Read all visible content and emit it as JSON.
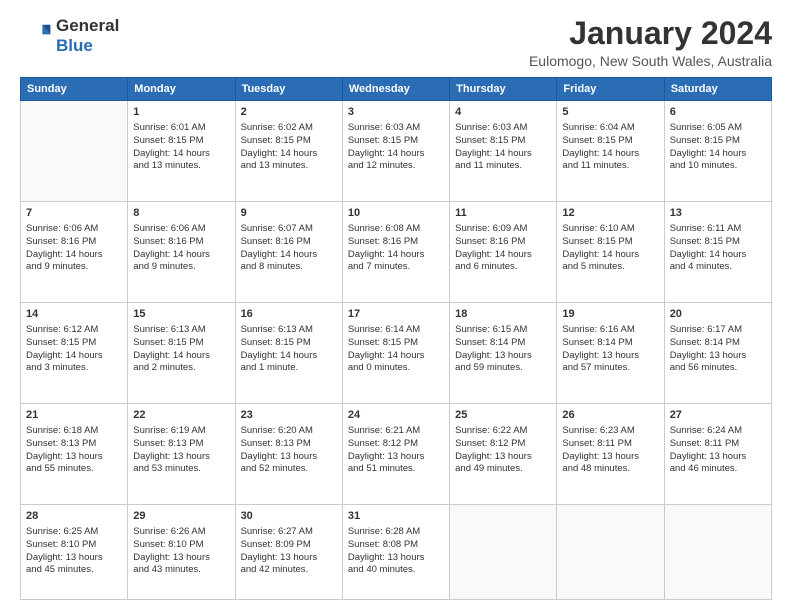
{
  "logo": {
    "line1": "General",
    "line2": "Blue"
  },
  "title": "January 2024",
  "subtitle": "Eulomogo, New South Wales, Australia",
  "days_of_week": [
    "Sunday",
    "Monday",
    "Tuesday",
    "Wednesday",
    "Thursday",
    "Friday",
    "Saturday"
  ],
  "weeks": [
    [
      {
        "day": "",
        "info": ""
      },
      {
        "day": "1",
        "info": "Sunrise: 6:01 AM\nSunset: 8:15 PM\nDaylight: 14 hours\nand 13 minutes."
      },
      {
        "day": "2",
        "info": "Sunrise: 6:02 AM\nSunset: 8:15 PM\nDaylight: 14 hours\nand 13 minutes."
      },
      {
        "day": "3",
        "info": "Sunrise: 6:03 AM\nSunset: 8:15 PM\nDaylight: 14 hours\nand 12 minutes."
      },
      {
        "day": "4",
        "info": "Sunrise: 6:03 AM\nSunset: 8:15 PM\nDaylight: 14 hours\nand 11 minutes."
      },
      {
        "day": "5",
        "info": "Sunrise: 6:04 AM\nSunset: 8:15 PM\nDaylight: 14 hours\nand 11 minutes."
      },
      {
        "day": "6",
        "info": "Sunrise: 6:05 AM\nSunset: 8:15 PM\nDaylight: 14 hours\nand 10 minutes."
      }
    ],
    [
      {
        "day": "7",
        "info": "Sunrise: 6:06 AM\nSunset: 8:16 PM\nDaylight: 14 hours\nand 9 minutes."
      },
      {
        "day": "8",
        "info": "Sunrise: 6:06 AM\nSunset: 8:16 PM\nDaylight: 14 hours\nand 9 minutes."
      },
      {
        "day": "9",
        "info": "Sunrise: 6:07 AM\nSunset: 8:16 PM\nDaylight: 14 hours\nand 8 minutes."
      },
      {
        "day": "10",
        "info": "Sunrise: 6:08 AM\nSunset: 8:16 PM\nDaylight: 14 hours\nand 7 minutes."
      },
      {
        "day": "11",
        "info": "Sunrise: 6:09 AM\nSunset: 8:16 PM\nDaylight: 14 hours\nand 6 minutes."
      },
      {
        "day": "12",
        "info": "Sunrise: 6:10 AM\nSunset: 8:15 PM\nDaylight: 14 hours\nand 5 minutes."
      },
      {
        "day": "13",
        "info": "Sunrise: 6:11 AM\nSunset: 8:15 PM\nDaylight: 14 hours\nand 4 minutes."
      }
    ],
    [
      {
        "day": "14",
        "info": "Sunrise: 6:12 AM\nSunset: 8:15 PM\nDaylight: 14 hours\nand 3 minutes."
      },
      {
        "day": "15",
        "info": "Sunrise: 6:13 AM\nSunset: 8:15 PM\nDaylight: 14 hours\nand 2 minutes."
      },
      {
        "day": "16",
        "info": "Sunrise: 6:13 AM\nSunset: 8:15 PM\nDaylight: 14 hours\nand 1 minute."
      },
      {
        "day": "17",
        "info": "Sunrise: 6:14 AM\nSunset: 8:15 PM\nDaylight: 14 hours\nand 0 minutes."
      },
      {
        "day": "18",
        "info": "Sunrise: 6:15 AM\nSunset: 8:14 PM\nDaylight: 13 hours\nand 59 minutes."
      },
      {
        "day": "19",
        "info": "Sunrise: 6:16 AM\nSunset: 8:14 PM\nDaylight: 13 hours\nand 57 minutes."
      },
      {
        "day": "20",
        "info": "Sunrise: 6:17 AM\nSunset: 8:14 PM\nDaylight: 13 hours\nand 56 minutes."
      }
    ],
    [
      {
        "day": "21",
        "info": "Sunrise: 6:18 AM\nSunset: 8:13 PM\nDaylight: 13 hours\nand 55 minutes."
      },
      {
        "day": "22",
        "info": "Sunrise: 6:19 AM\nSunset: 8:13 PM\nDaylight: 13 hours\nand 53 minutes."
      },
      {
        "day": "23",
        "info": "Sunrise: 6:20 AM\nSunset: 8:13 PM\nDaylight: 13 hours\nand 52 minutes."
      },
      {
        "day": "24",
        "info": "Sunrise: 6:21 AM\nSunset: 8:12 PM\nDaylight: 13 hours\nand 51 minutes."
      },
      {
        "day": "25",
        "info": "Sunrise: 6:22 AM\nSunset: 8:12 PM\nDaylight: 13 hours\nand 49 minutes."
      },
      {
        "day": "26",
        "info": "Sunrise: 6:23 AM\nSunset: 8:11 PM\nDaylight: 13 hours\nand 48 minutes."
      },
      {
        "day": "27",
        "info": "Sunrise: 6:24 AM\nSunset: 8:11 PM\nDaylight: 13 hours\nand 46 minutes."
      }
    ],
    [
      {
        "day": "28",
        "info": "Sunrise: 6:25 AM\nSunset: 8:10 PM\nDaylight: 13 hours\nand 45 minutes."
      },
      {
        "day": "29",
        "info": "Sunrise: 6:26 AM\nSunset: 8:10 PM\nDaylight: 13 hours\nand 43 minutes."
      },
      {
        "day": "30",
        "info": "Sunrise: 6:27 AM\nSunset: 8:09 PM\nDaylight: 13 hours\nand 42 minutes."
      },
      {
        "day": "31",
        "info": "Sunrise: 6:28 AM\nSunset: 8:08 PM\nDaylight: 13 hours\nand 40 minutes."
      },
      {
        "day": "",
        "info": ""
      },
      {
        "day": "",
        "info": ""
      },
      {
        "day": "",
        "info": ""
      }
    ]
  ]
}
